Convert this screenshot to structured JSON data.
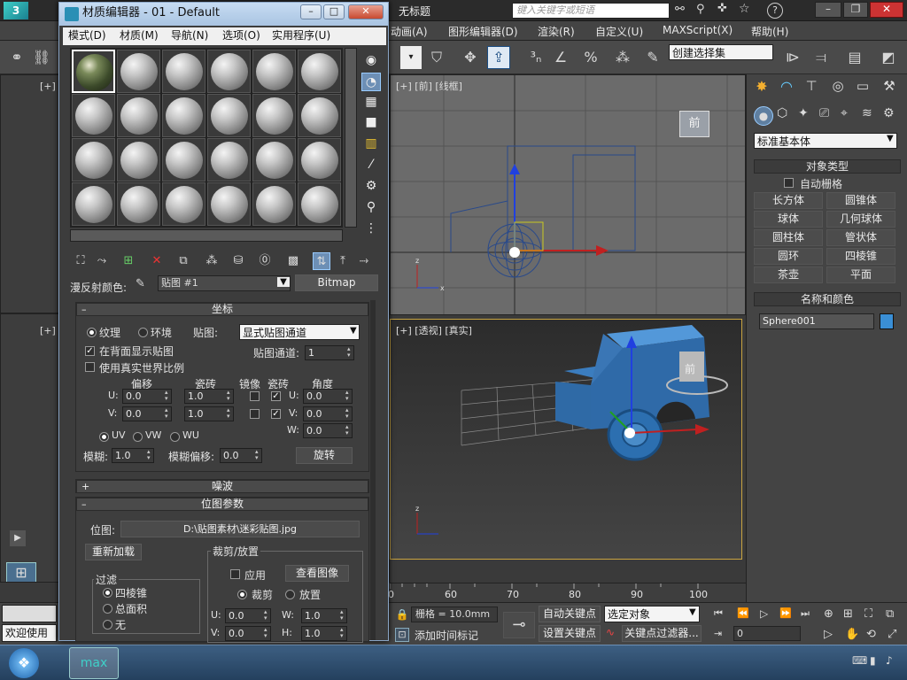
{
  "app": {
    "doc_title": "无标题",
    "search_placeholder": "键入关键字或短语"
  },
  "main_menu": [
    "动画(A)",
    "图形编辑器(D)",
    "渲染(R)",
    "自定义(U)",
    "MAXScript(X)",
    "帮助(H)"
  ],
  "toolbar": {
    "selection_set": "创建选择集"
  },
  "viewports": {
    "front_label": "[+] [前] [线框]",
    "persp_label": "[+] [透视] [真实]",
    "left_top_label": "[+]",
    "left_bottom_label": "[+]",
    "viewcube_front": "前"
  },
  "command_panel": {
    "category": "标准基本体",
    "object_type_header": "对象类型",
    "auto_grid": "自动栅格",
    "objects": [
      "长方体",
      "圆锥体",
      "球体",
      "几何球体",
      "圆柱体",
      "管状体",
      "圆环",
      "四棱锥",
      "茶壶",
      "平面"
    ],
    "name_color_header": "名称和颜色",
    "object_name": "Sphere001",
    "object_color": "#3a8fd6"
  },
  "timeline": {
    "ticks": [
      "0",
      "60",
      "70",
      "80",
      "90",
      "100"
    ]
  },
  "status": {
    "welcome": "欢迎使用",
    "grid": "栅格 = 10.0mm",
    "add_time_tag": "添加时间标记",
    "auto_key": "自动关键点",
    "set_key": "设置关键点",
    "key_mode": "选定对象",
    "key_filters": "关键点过滤器...",
    "frame": "0"
  },
  "material_editor": {
    "title": "材质编辑器 - 01 - Default",
    "menu": [
      "模式(D)",
      "材质(M)",
      "导航(N)",
      "选项(O)",
      "实用程序(U)"
    ],
    "diffuse_label": "漫反射颜色:",
    "map_name": "贴图 #1",
    "map_type": "Bitmap",
    "coords": {
      "header": "坐标",
      "texture": "纹理",
      "environ": "环境",
      "mapping_label": "贴图:",
      "mapping_value": "显式贴图通道",
      "show_back": "在背面显示贴图",
      "real_world": "使用真实世界比例",
      "map_channel_label": "贴图通道:",
      "map_channel": "1",
      "col_offset": "偏移",
      "col_tiling": "瓷砖",
      "col_mirror": "镜像",
      "col_tile": "瓷砖",
      "col_angle": "角度",
      "u_offset": "0.0",
      "v_offset": "0.0",
      "u_tiling": "1.0",
      "v_tiling": "1.0",
      "u_angle": "0.0",
      "v_angle": "0.0",
      "w_angle": "0.0",
      "u_label": "U:",
      "v_label": "V:",
      "w_label": "W:",
      "uv": "UV",
      "vw": "VW",
      "wu": "WU",
      "blur_label": "模糊:",
      "blur": "1.0",
      "blur_offset_label": "模糊偏移:",
      "blur_offset": "0.0",
      "rotate": "旋转"
    },
    "noise_header": "噪波",
    "bitmap": {
      "header": "位图参数",
      "bitmap_label": "位图:",
      "bitmap_path": "D:\\贴图素材\\迷彩贴图.jpg",
      "reload": "重新加载",
      "crop_header": "裁剪/放置",
      "apply": "应用",
      "view_image": "查看图像",
      "crop": "裁剪",
      "place": "放置",
      "filter_header": "过滤",
      "pyramidal": "四棱锥",
      "summed_area": "总面积",
      "none": "无",
      "u_label": "U:",
      "v_label": "V:",
      "w_label": "W:",
      "h_label": "H:",
      "u": "0.0",
      "v": "0.0",
      "w": "1.0",
      "h": "1.0"
    }
  }
}
